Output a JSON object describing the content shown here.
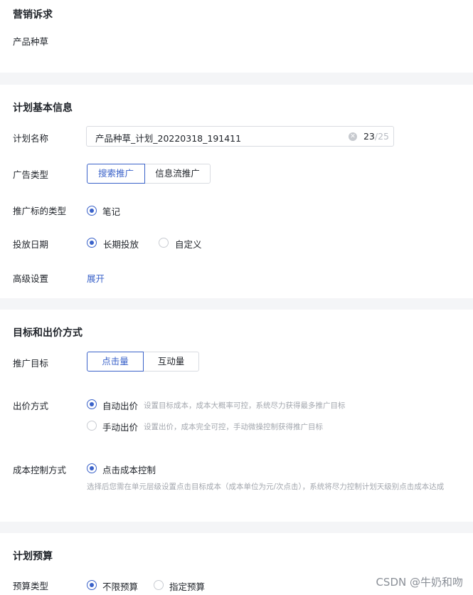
{
  "marketing": {
    "title": "营销诉求",
    "value": "产品种草"
  },
  "basic": {
    "title": "计划基本信息",
    "plan_name": {
      "label": "计划名称",
      "value": "产品种草_计划_20220318_191411",
      "count": "23",
      "separator": "/",
      "max": "25"
    },
    "ad_type": {
      "label": "广告类型",
      "options": [
        "搜索推广",
        "信息流推广"
      ],
      "selected": "搜索推广"
    },
    "target_type": {
      "label": "推广标的类型",
      "option": "笔记"
    },
    "delivery_date": {
      "label": "投放日期",
      "options": [
        "长期投放",
        "自定义"
      ],
      "selected": "长期投放"
    },
    "advanced": {
      "label": "高级设置",
      "expand": "展开"
    }
  },
  "goal": {
    "title": "目标和出价方式",
    "promotion_goal": {
      "label": "推广目标",
      "options": [
        "点击量",
        "互动量"
      ],
      "selected": "点击量"
    },
    "bid_method": {
      "label": "出价方式",
      "options": [
        {
          "name": "自动出价",
          "desc": "设置目标成本，成本大概率可控，系统尽力获得最多推广目标"
        },
        {
          "name": "手动出价",
          "desc": "设置出价，成本完全可控，手动微操控制获得推广目标"
        }
      ],
      "selected": "自动出价"
    },
    "cost_control": {
      "label": "成本控制方式",
      "option": "点击成本控制",
      "desc": "选择后您需在单元层级设置点击目标成本（成本单位为元/次点击），系统将尽力控制计划天级别点击成本达成"
    }
  },
  "budget": {
    "title": "计划预算",
    "budget_type": {
      "label": "预算类型",
      "options": [
        "不限预算",
        "指定预算"
      ],
      "selected": "不限预算"
    }
  },
  "watermark": "CSDN @牛奶和吻",
  "colors": {
    "accent": "#3a62c9",
    "page_bg": "#f4f5f7",
    "card_bg": "#ffffff",
    "hint": "#a3a7ae"
  },
  "icons": {
    "clear": "clear-icon",
    "radio_on": "radio-checked-icon",
    "radio_off": "radio-unchecked-icon"
  }
}
